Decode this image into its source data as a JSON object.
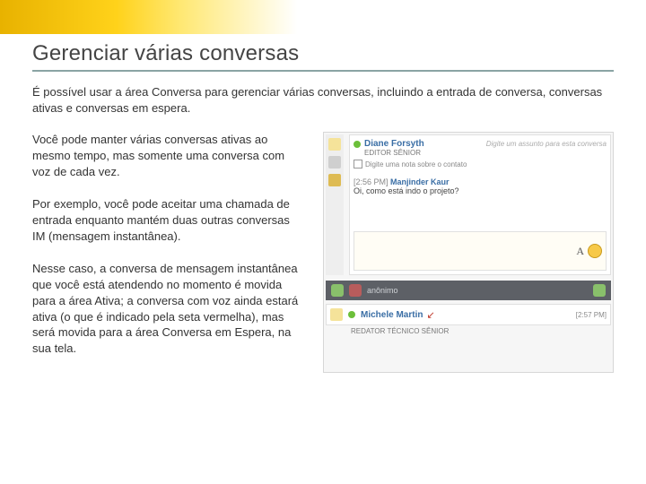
{
  "title": "Gerenciar várias conversas",
  "lead": "É possível usar a área Conversa para gerenciar várias conversas, incluindo a entrada de conversa, conversas ativas e conversas em espera.",
  "paragraphs": [
    "Você pode manter várias conversas ativas ao mesmo tempo, mas somente uma conversa com voz de cada vez.",
    "Por exemplo, você pode aceitar uma chamada de entrada enquanto mantém duas outras conversas IM (mensagem instantânea).",
    "Nesse caso, a conversa de mensagem instantânea que você está atendendo no momento é movida para a área Ativa; a conversa com voz ainda estará ativa (o que é indicado pela seta vermelha), mas será movida para a área Conversa em Espera, na sua tela."
  ],
  "chat": {
    "active": {
      "name": "Diane Forsyth",
      "role": "EDITOR SÊNIOR",
      "compose_hint": "Digite um assunto para esta conversa",
      "note_label": "Digite uma nota sobre o contato",
      "msg_time": "[2:56 PM]",
      "msg_from": "Manjinder Kaur",
      "msg_text": "Oi, como está indo o projeto?",
      "glyph_A": "A"
    },
    "bar": {
      "anon_label": "anônimo"
    },
    "hold": {
      "name": "Michele Martin",
      "role": "REDATOR TÉCNICO SÊNIOR",
      "time": "[2:57 PM]"
    }
  }
}
